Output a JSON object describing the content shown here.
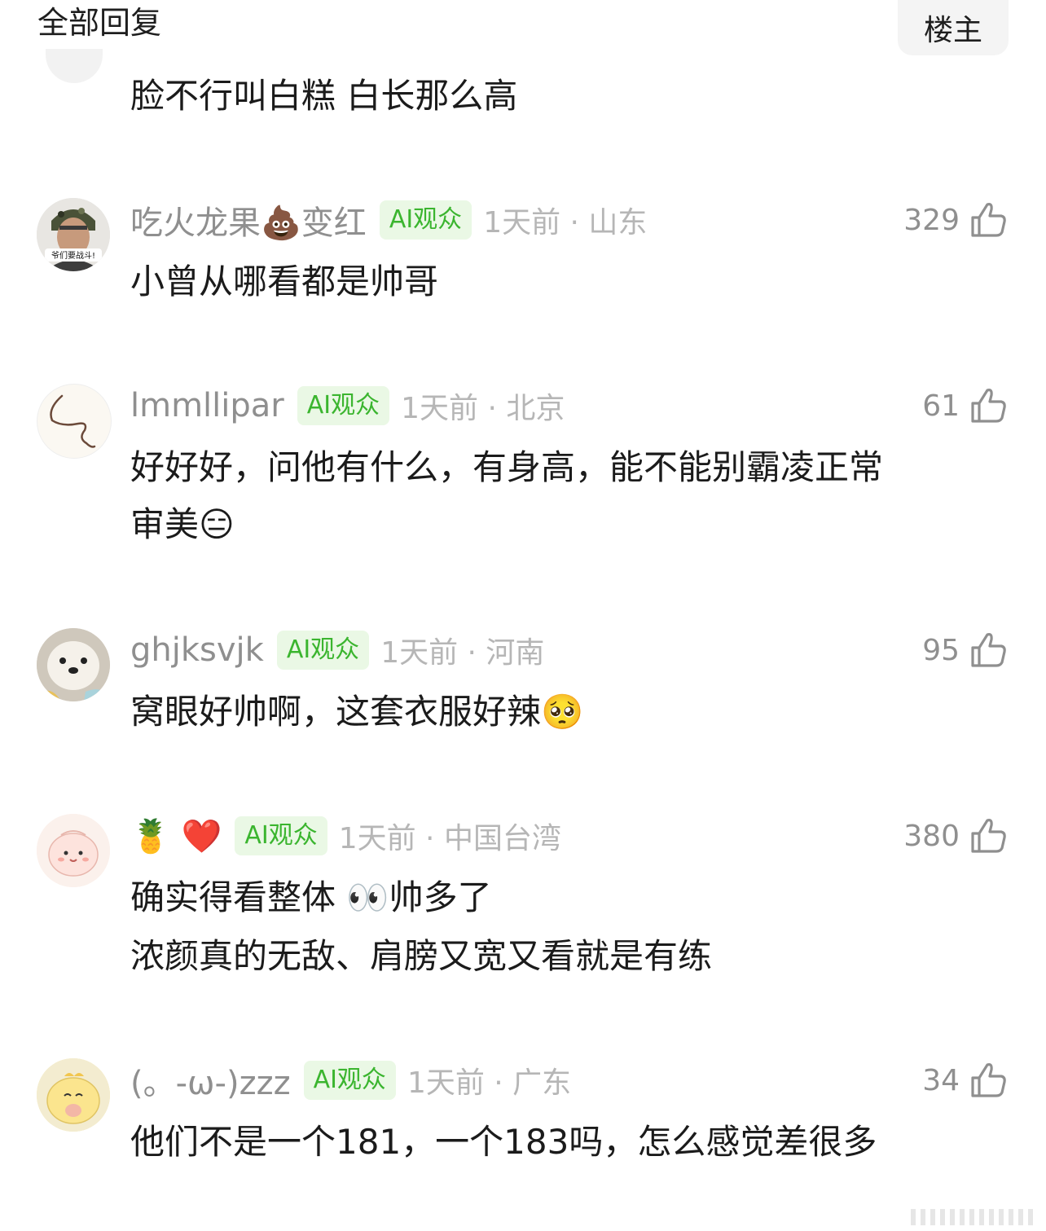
{
  "header": {
    "title": "全部回复",
    "op_filter": "楼主"
  },
  "prev_comment": {
    "text": "脸不行叫白糕 白长那么高"
  },
  "comments": [
    {
      "username": "吃火龙果💩变红",
      "badge": "AI观众",
      "time_location": "1天前 · 山东",
      "likes": "329",
      "lines": [
        "小曾从哪看都是帅哥"
      ],
      "avatar_caption": "爷们要战斗!"
    },
    {
      "username": "lmmllipar",
      "badge": "AI观众",
      "time_location": "1天前 · 北京",
      "likes": "61",
      "lines": [
        "好好好，问他有什么，有身高，能不能别霸凌正常",
        "审美😑"
      ]
    },
    {
      "username": "ghjksvjk",
      "badge": "AI观众",
      "time_location": "1天前 · 河南",
      "likes": "95",
      "lines": [
        "窝眼好帅啊，这套衣服好辣🥺"
      ]
    },
    {
      "username": "🍍 ❤️",
      "badge": "AI观众",
      "time_location": "1天前 · 中国台湾",
      "likes": "380",
      "lines": [
        "确实得看整体 👀帅多了",
        "浓颜真的无敌、肩膀又宽又看就是有练"
      ]
    },
    {
      "username": "(。-ω-)zzz",
      "badge": "AI观众",
      "time_location": "1天前 · 广东",
      "likes": "34",
      "lines": [
        "他们不是一个181，一个183吗，怎么感觉差很多"
      ]
    }
  ],
  "icons": {
    "like": "thumbs-up-icon"
  },
  "colors": {
    "badge_bg": "#eaf8e5",
    "badge_text": "#3bb52f",
    "meta_text": "#8f8f8f",
    "time_text": "#b6b6b6"
  }
}
